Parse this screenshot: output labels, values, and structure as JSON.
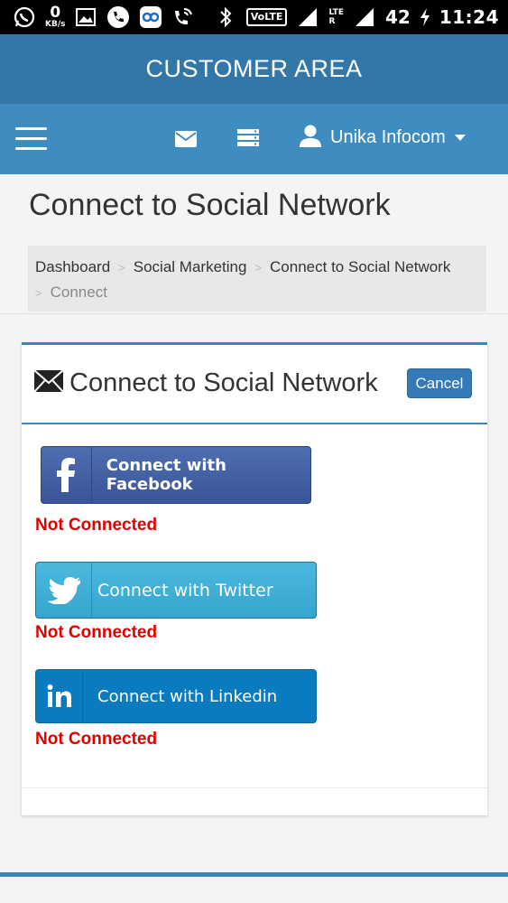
{
  "status_bar": {
    "net_speed": "0",
    "net_speed_unit": "KB/s",
    "volte": "VoLTE",
    "lte": "LTE",
    "sim": "R",
    "battery": "42",
    "time": "11:24"
  },
  "header": {
    "title": "CUSTOMER AREA"
  },
  "navbar": {
    "user_name": "Unika Infocom"
  },
  "page": {
    "title": "Connect to Social Network"
  },
  "breadcrumb": {
    "items": [
      "Dashboard",
      "Social Marketing",
      "Connect to Social Network"
    ],
    "separator": ">",
    "active": "Connect"
  },
  "panel": {
    "title": "Connect to Social Network",
    "cancel_label": "Cancel"
  },
  "social": [
    {
      "label": "Connect with Facebook",
      "status": "Not Connected"
    },
    {
      "label": "Connect with Twitter",
      "status": "Not Connected"
    },
    {
      "label": "Connect with Linkedin",
      "status": "Not Connected"
    }
  ],
  "colors": {
    "header": "#3377a8",
    "navbar": "#3f8dc0",
    "facebook": "#3b5998",
    "twitter": "#3db0d8",
    "linkedin": "#0b7bbf",
    "not_connected": "#e00000"
  },
  "icons": [
    "whatsapp-icon",
    "gallery-icon",
    "phone-icon",
    "app-icon",
    "wifi-call-icon",
    "bluetooth-icon",
    "signal-icon",
    "battery-charging-icon",
    "menu-icon",
    "mail-icon",
    "server-icon",
    "user-icon",
    "caret-down-icon",
    "envelope-icon",
    "facebook-icon",
    "twitter-icon",
    "linkedin-icon"
  ]
}
